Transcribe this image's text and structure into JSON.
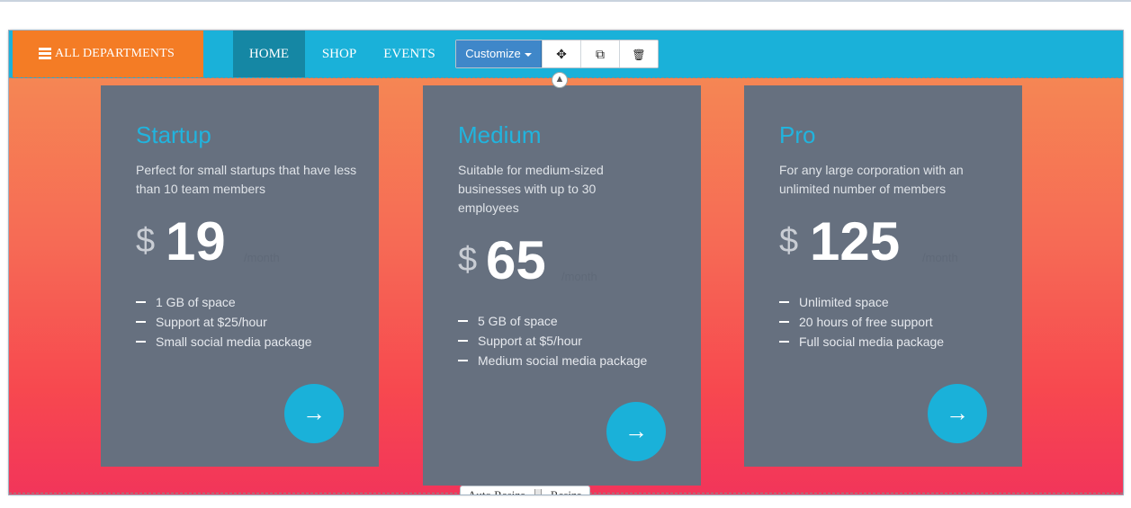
{
  "nav": {
    "departments_label": "ALL DEPARTMENTS",
    "items": [
      {
        "label": "HOME",
        "active": true
      },
      {
        "label": "SHOP",
        "active": false
      },
      {
        "label": "EVENTS",
        "active": false
      }
    ]
  },
  "toolbar": {
    "customize_label": "Customize",
    "buttons": [
      {
        "icon": "move-icon",
        "glyph": "✥"
      },
      {
        "icon": "copy-icon",
        "glyph": "⧉"
      },
      {
        "icon": "trash-icon",
        "glyph": "🗑"
      }
    ]
  },
  "plans": [
    {
      "name": "Startup",
      "description": "Perfect for small startups that have less than 10 team members",
      "currency": "$",
      "price": "19",
      "period": "/month",
      "features": [
        "1 GB of space",
        "Support at $25/hour",
        "Small social media package"
      ],
      "action_glyph": "→"
    },
    {
      "name": "Medium",
      "description": "Suitable for medium-sized businesses with up to 30 employees",
      "currency": "$",
      "price": "65",
      "period": "/month",
      "features": [
        "5 GB of space",
        "Support at $5/hour",
        "Medium social media package"
      ],
      "action_glyph": "→"
    },
    {
      "name": "Pro",
      "description": "For any large corporation with an unlimited number of members",
      "currency": "$",
      "price": "125",
      "period": "/month",
      "features": [
        "Unlimited space",
        "20 hours of free support",
        "Full social media package"
      ],
      "action_glyph": "→"
    }
  ],
  "resize": {
    "auto_label": "Auto Resize",
    "resize_label": "Resize"
  },
  "colors": {
    "nav": "#1ab1d9",
    "departments": "#f47c25",
    "card": "#66707f",
    "accent": "#21b4de"
  }
}
